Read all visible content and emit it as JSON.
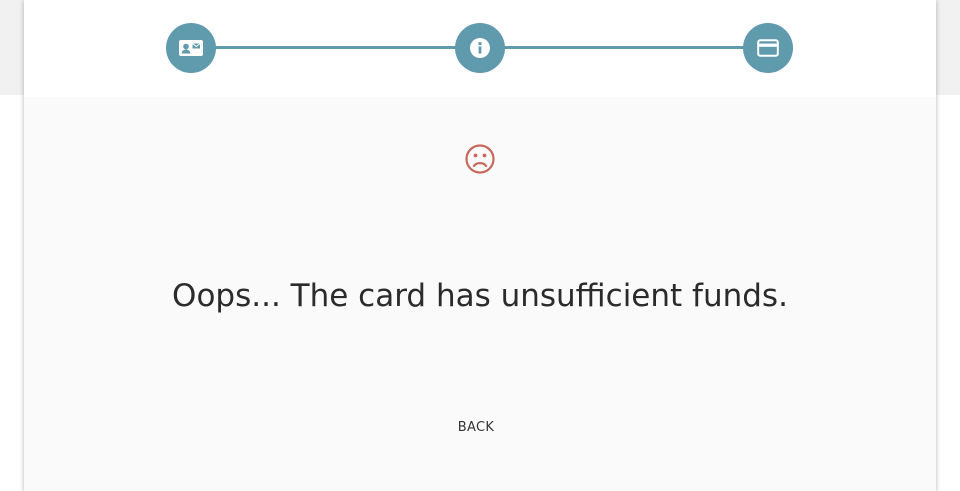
{
  "stepper": {
    "steps": [
      {
        "name": "contact-card-icon"
      },
      {
        "name": "info-icon"
      },
      {
        "name": "credit-card-icon"
      }
    ],
    "accent_color": "#5f9aad"
  },
  "status": {
    "icon": "sad-face-icon",
    "icon_color": "#c9695e",
    "message": "Oops... The card has unsufficient funds."
  },
  "actions": {
    "back_label": "BACK"
  }
}
